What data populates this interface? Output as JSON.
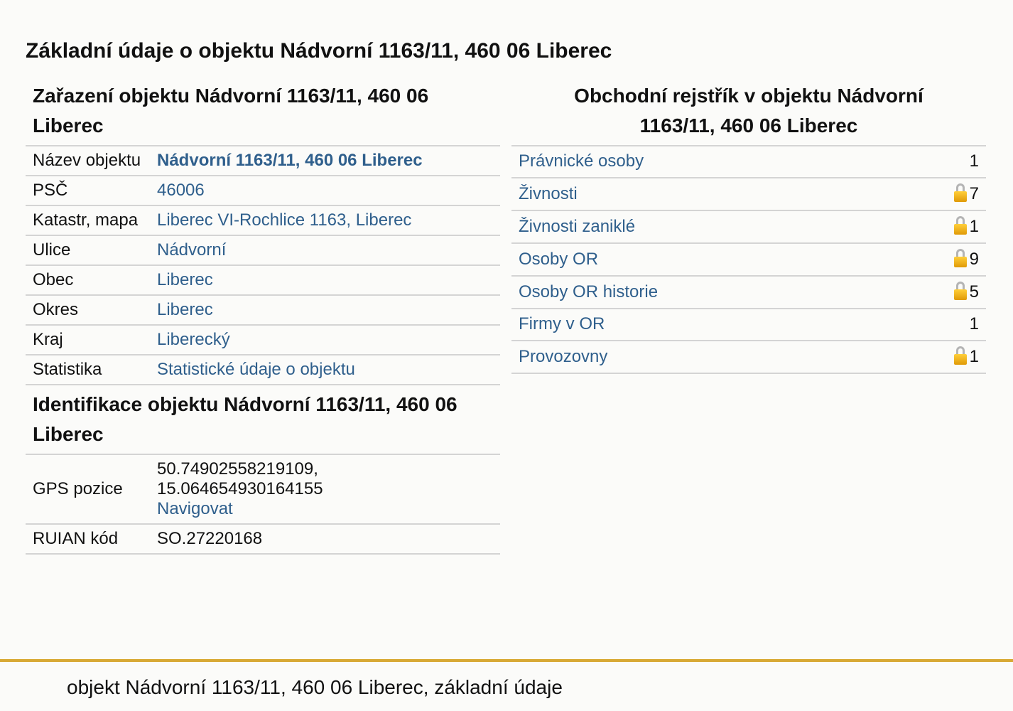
{
  "page_title": "Základní údaje o objektu Nádvorní 1163/11, 460 06 Liberec",
  "zarazeni": {
    "title": "Zařazení objektu Nádvorní 1163/11, 460 06 Liberec",
    "rows": [
      {
        "label": "Název objektu",
        "value": "Nádvorní 1163/11, 460 06 Liberec"
      },
      {
        "label": "PSČ",
        "value": "46006"
      },
      {
        "label": "Katastr, mapa",
        "value": "Liberec VI-Rochlice 1163, Liberec"
      },
      {
        "label": "Ulice",
        "value": "Nádvorní"
      },
      {
        "label": "Obec",
        "value": "Liberec"
      },
      {
        "label": "Okres",
        "value": "Liberec"
      },
      {
        "label": "Kraj",
        "value": "Liberecký"
      },
      {
        "label": "Statistika",
        "value": "Statistické údaje o objektu"
      }
    ]
  },
  "identifikace": {
    "title": "Identifikace objektu Nádvorní 1163/11, 460 06 Liberec",
    "gps_label": "GPS pozice",
    "gps_lat": "50.74902558219109,",
    "gps_lon": "15.064654930164155",
    "navigate": "Navigovat",
    "ruian_label": "RUIAN kód",
    "ruian_value": "SO.27220168"
  },
  "obchodni": {
    "title": "Obchodní rejstřík v objektu Nádvorní 1163/11, 460 06 Liberec",
    "rows": [
      {
        "label": "Právnické osoby",
        "count": "1",
        "locked": false
      },
      {
        "label": "Živnosti",
        "count": "7",
        "locked": true
      },
      {
        "label": "Živnosti zaniklé",
        "count": "1",
        "locked": true
      },
      {
        "label": "Osoby OR",
        "count": "9",
        "locked": true
      },
      {
        "label": "Osoby OR historie",
        "count": "5",
        "locked": true
      },
      {
        "label": "Firmy v OR",
        "count": "1",
        "locked": false
      },
      {
        "label": "Provozovny",
        "count": "1",
        "locked": true
      }
    ]
  },
  "footer": {
    "text": "objekt Nádvorní 1163/11, 460 06 Liberec, základní údaje",
    "accent_color": "#d8a935"
  },
  "colors": {
    "link": "#2f5f8c",
    "divider": "#d4d4d4"
  }
}
